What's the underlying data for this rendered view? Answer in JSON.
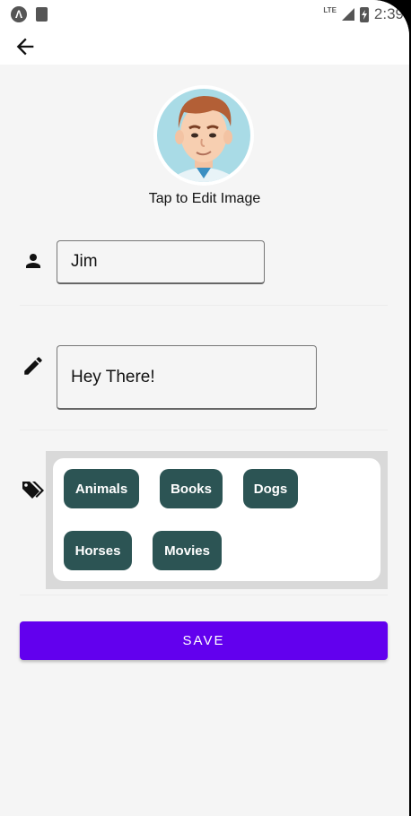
{
  "status_bar": {
    "time": "2:39",
    "network": "LTE",
    "app_badge": "Λ"
  },
  "profile": {
    "edit_image_label": "Tap to Edit Image"
  },
  "form": {
    "name_value": "Jim",
    "status_value": "Hey There!",
    "save_label": "SAVE"
  },
  "tags": [
    "Animals",
    "Books",
    "Dogs",
    "Horses",
    "Movies"
  ],
  "icons": {
    "back": "arrow-back-icon",
    "name": "person-icon",
    "status": "pencil-icon",
    "tags": "tags-icon"
  },
  "colors": {
    "accent": "#6200ee",
    "chip": "#2c5454",
    "background": "#f5f5f5"
  }
}
